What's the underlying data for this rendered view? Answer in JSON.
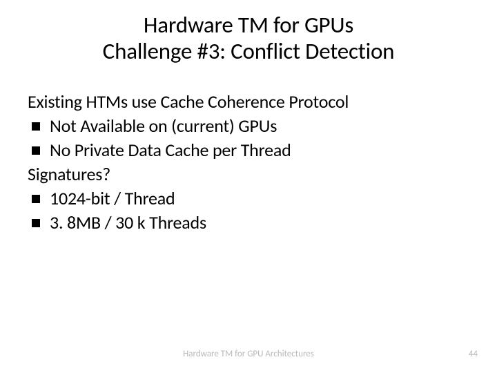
{
  "title_line1": "Hardware TM for GPUs",
  "title_line2": "Challenge #3: Conflict Detection",
  "body": {
    "p1": "Existing HTMs use Cache Coherence Protocol",
    "b1": "Not Available on (current) GPUs",
    "b2": "No Private Data Cache per Thread",
    "p2": "Signatures?",
    "b3": "1024-bit / Thread",
    "b4": "3. 8MB / 30 k Threads"
  },
  "footer": "Hardware TM for GPU Architectures",
  "page": "44"
}
